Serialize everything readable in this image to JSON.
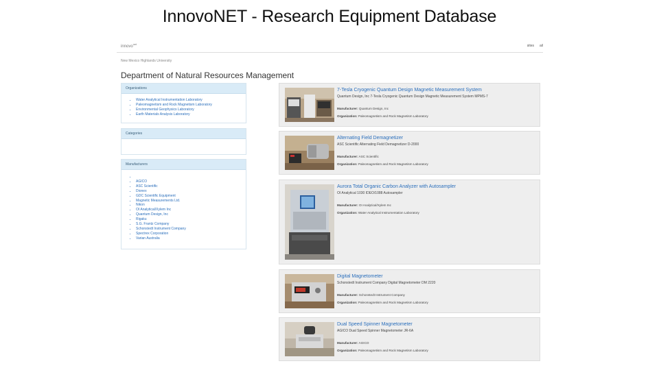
{
  "slide_title": "InnovoNET - Research Equipment Database",
  "brand": {
    "name": "innovo",
    "sup": "net"
  },
  "top_links": [
    "sites",
    "ail"
  ],
  "breadcrumb": "New Mexico Highlands University",
  "department": "Department of Natural Resources Management",
  "organizations": {
    "header": "Organizations",
    "items": [
      "Water Analytical Instrumentation Laboratory",
      "Paleomagnetism and Rock Magnetism Laboratory",
      "Environmental Geophysics Laboratory",
      "Earth Materials Analysis Laboratory"
    ]
  },
  "categories": {
    "header": "Categories"
  },
  "manufacturers": {
    "header": "Manufacturers",
    "items": [
      "",
      "AGICO",
      "ASC Scientific",
      "Dionex",
      "GDC Scientific Equipment",
      "Magnetic Measurements Ltd.",
      "Nikon",
      "OI Analytical/Xylem Inc",
      "Quantum Design, Inc",
      "Rigaku",
      "S.G. Frantz Company",
      "Schonstedt Instrument Company",
      "Spectrex Corporation",
      "Varian Australia"
    ]
  },
  "labels": {
    "manufacturer": "Manufacturer:",
    "organization": "Organization:"
  },
  "equipment": [
    {
      "title": "7-Tesla Cryogenic Quantum Design Magnetic Measurement System",
      "subtitle": "Quantum Design, Inc 7-Tesla Cryogenic Quantum Design Magnetic Measurement System MPMS-7",
      "manufacturer": "Quantum Design, Inc",
      "organization": "Paleomagnetism and Rock Magnetism Laboratory"
    },
    {
      "title": "Alternating Field Demagnetizer",
      "subtitle": "ASC Scientific Alternating Field Demagnetizer D-2000",
      "manufacturer": "ASC Scientific",
      "organization": "Paleomagnetism and Rock Magnetism Laboratory"
    },
    {
      "title": "Aurora Total Organic Carbon Analyzer with Autosampler",
      "subtitle": "OI Analytical 1030 IDEO/1088 Autosampler",
      "manufacturer": "OI Analytical/Xylem Inc",
      "organization": "Water Analytical Instrumentation Laboratory"
    },
    {
      "title": "Digital Magnetometer",
      "subtitle": "Schonstedt Instrument Company Digital Magnetometer DM 2220",
      "manufacturer": "Schonstedt Instrument Company",
      "organization": "Paleomagnetism and Rock Magnetism Laboratory"
    },
    {
      "title": "Dual Speed Spinner Magnetometer",
      "subtitle": "AGICO Dual Speed Spinner Magnetometer JR-6A",
      "manufacturer": "AGICO",
      "organization": "Paleomagnetism and Rock Magnetism Laboratory"
    }
  ]
}
